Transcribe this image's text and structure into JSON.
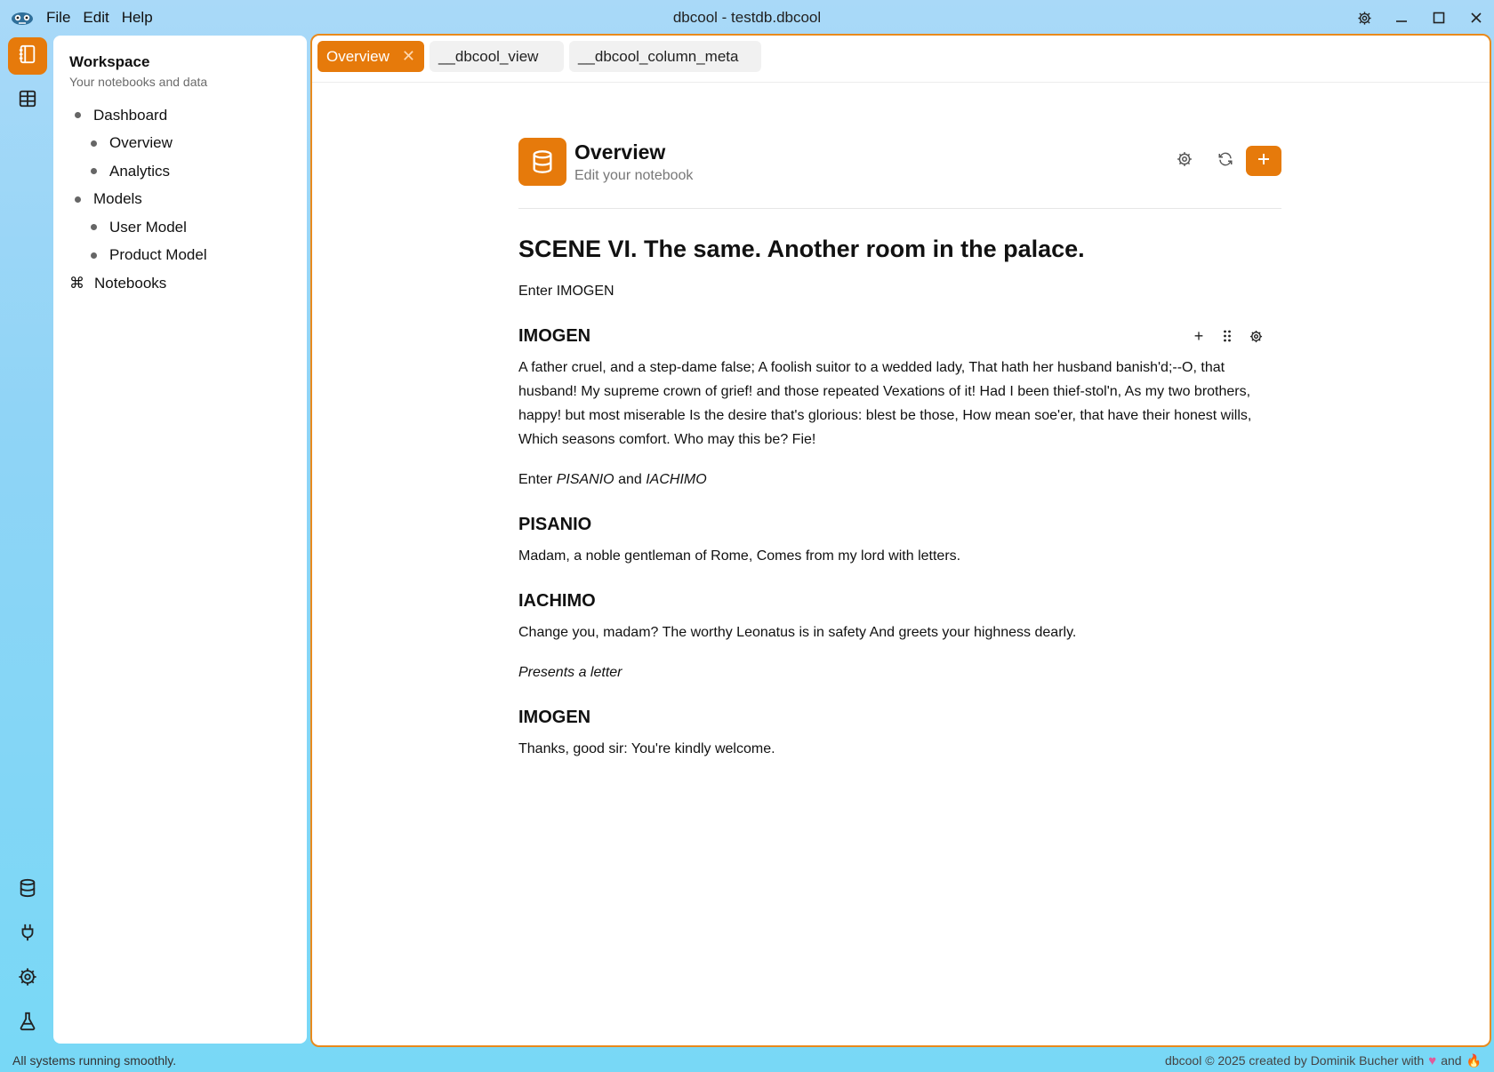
{
  "window": {
    "title": "dbcool - testdb.dbcool"
  },
  "menu": {
    "items": [
      "File",
      "Edit",
      "Help"
    ]
  },
  "colors": {
    "accent": "#e67a0b",
    "border": "#e98a1c"
  },
  "activitybar": {
    "top_items": [
      "notebook-icon",
      "table-icon"
    ],
    "bottom_items": [
      "database-icon",
      "plug-icon",
      "gear-icon",
      "flask-icon"
    ]
  },
  "sidebar": {
    "title": "Workspace",
    "subtitle": "Your notebooks and data",
    "items": [
      {
        "label": "Dashboard"
      },
      {
        "label": "Overview"
      },
      {
        "label": "Analytics"
      },
      {
        "label": "Models"
      },
      {
        "label": "User Model"
      },
      {
        "label": "Product Model"
      },
      {
        "label": "Notebooks"
      }
    ]
  },
  "tabs": [
    {
      "label": "Overview"
    },
    {
      "label": "__dbcool_view"
    },
    {
      "label": "__dbcool_column_meta"
    }
  ],
  "notebook": {
    "title": "Overview",
    "subtitle": "Edit your notebook",
    "scene_title": "SCENE VI. The same. Another room in the palace.",
    "stage1": "Enter IMOGEN",
    "speaker1": "IMOGEN",
    "speech1": "A father cruel, and a step-dame false; A foolish suitor to a wedded lady, That hath her husband banish'd;--O, that husband! My supreme crown of grief! and those repeated Vexations of it! Had I been thief-stol'n, As my two brothers, happy! but most miserable Is the desire that's glorious: blest be those, How mean soe'er, that have their honest wills, Which seasons comfort. Who may this be? Fie!",
    "stage2_prefix": "Enter",
    "stage2_name1": "PISANIO",
    "stage2_and": "and",
    "stage2_name2": "IACHIMO",
    "speaker2": "PISANIO",
    "speech2": "Madam, a noble gentleman of Rome, Comes from my lord with letters.",
    "speaker3": "IACHIMO",
    "speech3": "Change you, madam? The worthy Leonatus is in safety And greets your highness dearly.",
    "stage3": "Presents a letter",
    "speaker4": "IMOGEN",
    "speech4": "Thanks, good sir: You're kindly welcome."
  },
  "status": {
    "left": "All systems running smoothly.",
    "right_prefix": "dbcool © 2025 created by Dominik Bucher with",
    "right_and": "and"
  }
}
